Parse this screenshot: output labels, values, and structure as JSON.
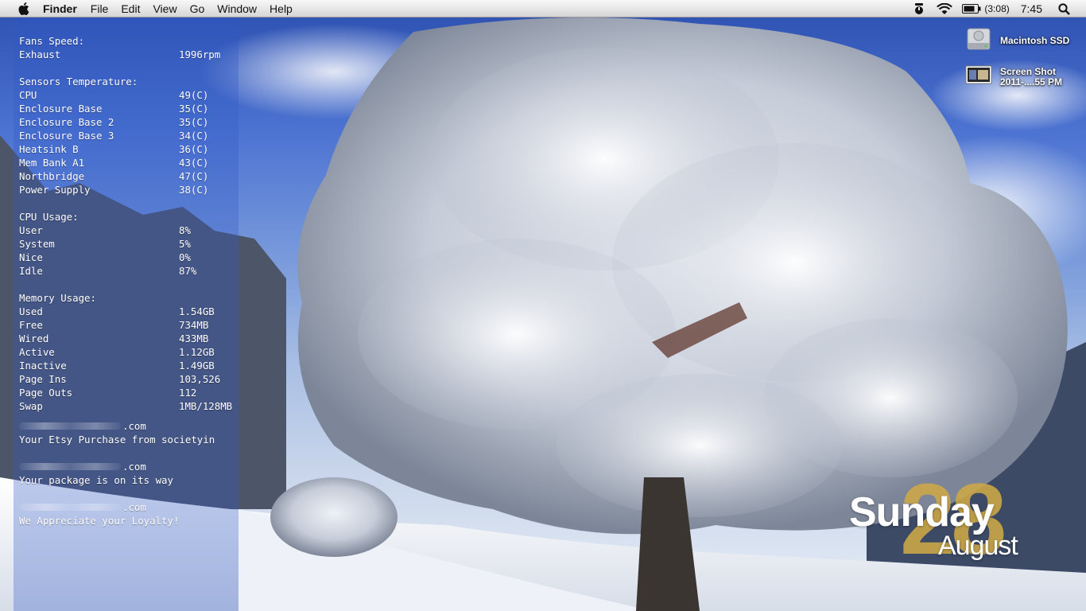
{
  "menubar": {
    "app_name": "Finder",
    "items": [
      "File",
      "Edit",
      "View",
      "Go",
      "Window",
      "Help"
    ],
    "battery": "(3:08)",
    "clock": "7:45"
  },
  "stats": {
    "fans": {
      "title": "Fans Speed:",
      "rows": [
        {
          "label": "Exhaust",
          "value": "1996rpm"
        }
      ]
    },
    "temps": {
      "title": "Sensors Temperature:",
      "rows": [
        {
          "label": "CPU",
          "value": "49(C)"
        },
        {
          "label": "Enclosure Base",
          "value": "35(C)"
        },
        {
          "label": "Enclosure Base 2",
          "value": "35(C)"
        },
        {
          "label": "Enclosure Base 3",
          "value": "34(C)"
        },
        {
          "label": "Heatsink B",
          "value": "36(C)"
        },
        {
          "label": "Mem Bank A1",
          "value": "43(C)"
        },
        {
          "label": "Northbridge",
          "value": "47(C)"
        },
        {
          "label": "Power Supply",
          "value": "38(C)"
        }
      ]
    },
    "cpu": {
      "title": "CPU Usage:",
      "rows": [
        {
          "label": "User",
          "value": "8%"
        },
        {
          "label": "System",
          "value": "5%"
        },
        {
          "label": "Nice",
          "value": "0%"
        },
        {
          "label": "Idle",
          "value": "87%"
        }
      ]
    },
    "memory": {
      "title": "Memory Usage:",
      "rows": [
        {
          "label": "Used",
          "value": "1.54GB"
        },
        {
          "label": "Free",
          "value": "734MB"
        },
        {
          "label": "Wired",
          "value": "433MB"
        },
        {
          "label": "Active",
          "value": "1.12GB"
        },
        {
          "label": "Inactive",
          "value": "1.49GB"
        },
        {
          "label": "Page Ins",
          "value": "103,526"
        },
        {
          "label": "Page Outs",
          "value": "112"
        },
        {
          "label": "Swap",
          "value": "1MB/128MB"
        }
      ]
    }
  },
  "mail": [
    {
      "domain": ".com",
      "subject": "Your Etsy Purchase from societyin"
    },
    {
      "domain": ".com",
      "subject": "Your package is on its way"
    },
    {
      "domain": ".com",
      "subject": "We Appreciate your Loyalty!"
    }
  ],
  "desktop_icons": [
    {
      "label_line1": "Macintosh SSD",
      "label_line2": "",
      "icon": "hard-drive-icon"
    },
    {
      "label_line1": "Screen Shot",
      "label_line2": "2011-....55 PM",
      "icon": "screenshot-thumbnail-icon"
    }
  ],
  "date_widget": {
    "day": "Sunday",
    "number": "28",
    "month": "August",
    "number_color": "#cea846"
  },
  "colors": {
    "sky": "#4d74d2",
    "panel": "#3a5ec8",
    "snow": "#f2f4f8"
  }
}
